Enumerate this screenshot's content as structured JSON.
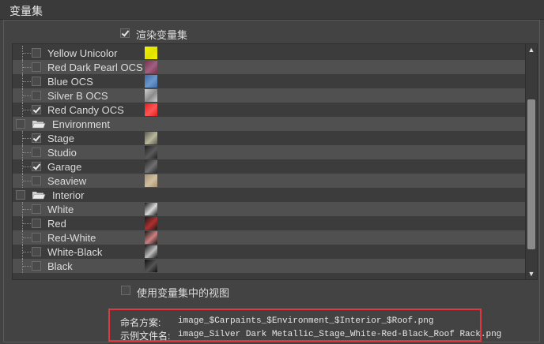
{
  "window": {
    "title": "变量集"
  },
  "render_variants": {
    "label": "渲染变量集",
    "checked": true
  },
  "tree": {
    "rows": [
      {
        "label": "Yellow Unicolor",
        "checked": false,
        "thumb": "yellow-swatch",
        "color": "#f2f200",
        "color2": "#e0e000"
      },
      {
        "label": "Red Dark Pearl OCS",
        "checked": false,
        "thumb": "red-dark-pearl-swatch",
        "color": "#7a3050",
        "color2": "#a06080"
      },
      {
        "label": "Blue OCS",
        "checked": false,
        "thumb": "blue-swatch",
        "color": "#3d6aa8",
        "color2": "#6a98cc"
      },
      {
        "label": "Silver B OCS",
        "checked": false,
        "thumb": "silver-swatch",
        "color": "#cfcfcf",
        "color2": "#8a8a8a"
      },
      {
        "label": "Red Candy OCS",
        "checked": true,
        "thumb": "red-candy-swatch",
        "color": "#e02020",
        "color2": "#ff5555"
      },
      {
        "label": "Environment",
        "checked": false,
        "group": true
      },
      {
        "label": "Stage",
        "checked": true,
        "thumb": "stage-thumb",
        "color": "#5a5a48",
        "color2": "#b8b8a0"
      },
      {
        "label": "Studio",
        "checked": false,
        "thumb": "studio-thumb",
        "color": "#222222",
        "color2": "#5a5a5a"
      },
      {
        "label": "Garage",
        "checked": true,
        "thumb": "garage-thumb",
        "color": "#2a2a2a",
        "color2": "#707070"
      },
      {
        "label": "Seaview",
        "checked": false,
        "thumb": "seaview-thumb",
        "color": "#a89070",
        "color2": "#d0c0a0"
      },
      {
        "label": "Interior",
        "checked": false,
        "group": true
      },
      {
        "label": "White",
        "checked": false,
        "thumb": "interior-white-thumb",
        "color": "#1a1a1a",
        "color2": "#d8d8d8"
      },
      {
        "label": "Red",
        "checked": false,
        "thumb": "interior-red-thumb",
        "color": "#1a1a1a",
        "color2": "#b03030"
      },
      {
        "label": "Red-White",
        "checked": false,
        "thumb": "interior-red-white-thumb",
        "color": "#1a1a1a",
        "color2": "#cc8080"
      },
      {
        "label": "White-Black",
        "checked": false,
        "thumb": "interior-white-black-thumb",
        "color": "#1a1a1a",
        "color2": "#bdbdbd"
      },
      {
        "label": "Black",
        "checked": false,
        "thumb": "interior-black-thumb",
        "color": "#101010",
        "color2": "#555555"
      }
    ]
  },
  "use_view": {
    "label": "使用变量集中的视图",
    "checked": false
  },
  "naming": {
    "scheme_label": "命名方案:",
    "scheme_value": "image_$Carpaints_$Environment_$Interior_$Roof.png",
    "example_label": "示例文件名:",
    "example_value": "image_Silver Dark Metallic_Stage_White-Red-Black_Roof Rack.png"
  },
  "colors": {
    "highlight": "#e0383c",
    "panel": "#434343"
  }
}
